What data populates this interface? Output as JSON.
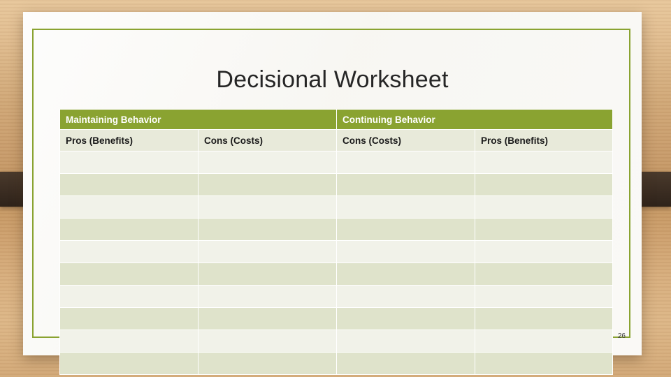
{
  "slide": {
    "title": "Decisional Worksheet",
    "page_number": "26",
    "table": {
      "group_headers": [
        {
          "label": "Maintaining Behavior",
          "span": 2
        },
        {
          "label": "Continuing  Behavior",
          "span": 2
        }
      ],
      "column_headers": [
        "Pros (Benefits)",
        "Cons (Costs)",
        "Cons (Costs)",
        "Pros (Benefits)"
      ],
      "rows": [
        [
          "",
          "",
          "",
          ""
        ],
        [
          "",
          "",
          "",
          ""
        ],
        [
          "",
          "",
          "",
          ""
        ],
        [
          "",
          "",
          "",
          ""
        ],
        [
          "",
          "",
          "",
          ""
        ],
        [
          "",
          "",
          "",
          ""
        ],
        [
          "",
          "",
          "",
          ""
        ],
        [
          "",
          "",
          "",
          ""
        ],
        [
          "",
          "",
          "",
          ""
        ],
        [
          "",
          "",
          "",
          ""
        ]
      ]
    }
  },
  "theme": {
    "accent": "#8aa331",
    "row_light": "#f1f2e9",
    "row_dark": "#dfe3cb",
    "subheader_bg": "#e8eada",
    "sheet_bg": "#f7f6f2"
  }
}
